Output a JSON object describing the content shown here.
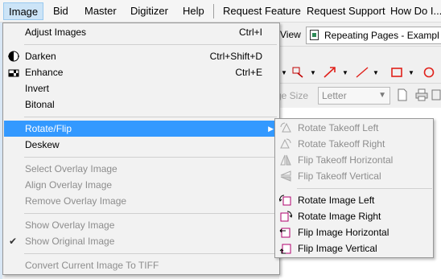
{
  "menubar": {
    "items": [
      {
        "label": "Image",
        "active": true
      },
      {
        "label": "Bid"
      },
      {
        "label": "Master"
      },
      {
        "label": "Digitizer"
      },
      {
        "label": "Help"
      },
      {
        "label": "Request Feature"
      },
      {
        "label": "Request Support"
      },
      {
        "label": "How Do I..."
      }
    ]
  },
  "background": {
    "view_label": "View",
    "page_select_value": "Repeating Pages - Exampl",
    "size_label": "ge Size",
    "size_value": "Letter"
  },
  "image_menu": {
    "items": [
      {
        "label": "Adjust Images",
        "shortcut": "Ctrl+I"
      },
      {
        "label": "Darken",
        "shortcut": "Ctrl+Shift+D",
        "icon": "darken-icon"
      },
      {
        "label": "Enhance",
        "shortcut": "Ctrl+E",
        "icon": "enhance-icon"
      },
      {
        "label": "Invert"
      },
      {
        "label": "Bitonal"
      },
      {
        "label": "Rotate/Flip",
        "highlighted": true,
        "has_submenu": true
      },
      {
        "label": "Deskew"
      },
      {
        "label": "Select Overlay Image",
        "disabled": true
      },
      {
        "label": "Align Overlay Image",
        "disabled": true
      },
      {
        "label": "Remove Overlay Image",
        "disabled": true
      },
      {
        "label": "Show Overlay Image",
        "disabled": true
      },
      {
        "label": "Show Original Image",
        "disabled": true,
        "checked": true
      },
      {
        "label": "Convert Current Image To TIFF",
        "disabled": true
      }
    ]
  },
  "rotate_flip_submenu": {
    "items": [
      {
        "label": "Rotate Takeoff Left",
        "disabled": true,
        "icon": "rotate-takeoff-left-icon"
      },
      {
        "label": "Rotate Takeoff Right",
        "disabled": true,
        "icon": "rotate-takeoff-right-icon"
      },
      {
        "label": "Flip Takeoff Horizontal",
        "disabled": true,
        "icon": "flip-takeoff-horizontal-icon"
      },
      {
        "label": "Flip Takeoff Vertical",
        "disabled": true,
        "icon": "flip-takeoff-vertical-icon"
      },
      {
        "label": "Rotate Image Left",
        "icon": "rotate-image-left-icon"
      },
      {
        "label": "Rotate Image Right",
        "icon": "rotate-image-right-icon"
      },
      {
        "label": "Flip Image Horizontal",
        "icon": "flip-image-horizontal-icon"
      },
      {
        "label": "Flip Image Vertical",
        "icon": "flip-image-vertical-icon"
      }
    ]
  },
  "colors": {
    "highlight": "#3399ff",
    "menubar_active": "#cce4f7",
    "disabled_text": "#8d8d8d",
    "icon_magenta": "#b0006e"
  }
}
